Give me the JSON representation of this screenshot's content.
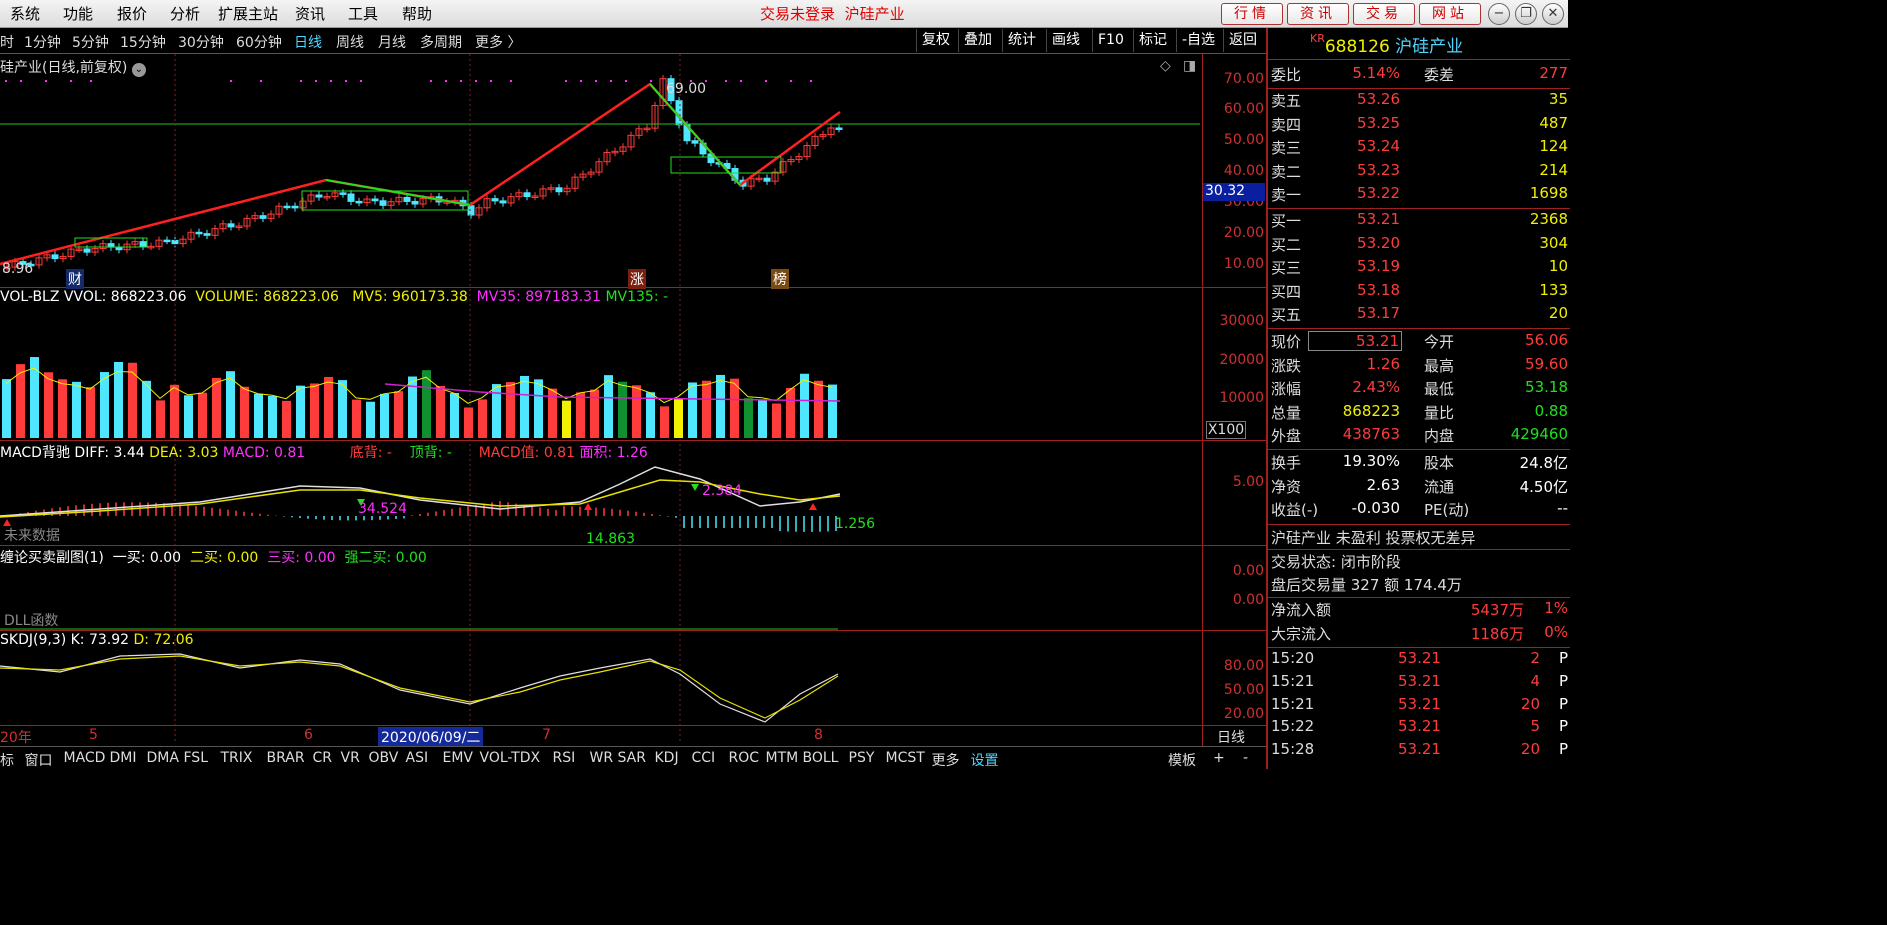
{
  "menubar": {
    "items": [
      "系统",
      "功能",
      "报价",
      "分析",
      "扩展主站",
      "资讯",
      "工具",
      "帮助"
    ],
    "status": "交易未登录",
    "stock_name": "沪硅产业",
    "buttons": [
      "行情",
      "资讯",
      "交易",
      "网站"
    ]
  },
  "periods": [
    "时",
    "1分钟",
    "5分钟",
    "15分钟",
    "30分钟",
    "60分钟",
    "日线",
    "周线",
    "月线",
    "多周期",
    "更多 〉"
  ],
  "toolbar": [
    "复权",
    "叠加",
    "统计",
    "画线",
    "F10",
    "标记",
    "-自选",
    "返回"
  ],
  "main_chart": {
    "title": "硅产业(日线,前复权)",
    "y_ticks": [
      "70.00",
      "60.00",
      "50.00",
      "40.00",
      "30.00",
      "20.00",
      "10.00"
    ],
    "high_label": "69.00",
    "low_label": "8.96",
    "current_marker": "30.32",
    "event_labels": [
      "财",
      "涨",
      "榜"
    ]
  },
  "volume": {
    "legend": {
      "name": "VOL-BLZ",
      "vvol": "VVOL: 868223.06",
      "volume": "VOLUME: 868223.06",
      "mv5": "MV5: 960173.38",
      "mv35": "MV35: 897183.31",
      "mv135": "MV135: -"
    },
    "y_ticks": [
      "30000",
      "20000",
      "10000"
    ],
    "unit": "X100"
  },
  "macd": {
    "legend": {
      "name": "MACD背驰",
      "diff": "DIFF: 3.44",
      "dea": "DEA: 3.03",
      "macd": "MACD: 0.81",
      "dibei": "底背: -",
      "dingbei": "顶背: -",
      "macdval": "MACD值: 0.81",
      "area": "面积: 1.26"
    },
    "y_ticks": [
      "5.00"
    ],
    "labels": [
      "34.524",
      "2.384",
      "14.863",
      "1.256"
    ],
    "note": "未来数据"
  },
  "chanlun": {
    "legend": {
      "name": "缠论买卖副图(1)",
      "b1": "一买: 0.00",
      "b2": "二买: 0.00",
      "b3": "三买: 0.00",
      "sb2": "强二买: 0.00"
    },
    "y_ticks": [
      "0.00",
      "0.00"
    ],
    "note": "DLL函数"
  },
  "skdj": {
    "legend": {
      "name": "SKDJ(9,3)",
      "k": "K: 73.92",
      "d": "D: 72.06"
    },
    "y_ticks": [
      "80.00",
      "50.00",
      "20.00"
    ]
  },
  "date_axis": {
    "labels": [
      "20年",
      "5",
      "6",
      "2020/06/09/二",
      "7",
      "8"
    ],
    "period": "日线"
  },
  "bottom_tabs": [
    "标",
    "窗口",
    "MACD",
    "DMI",
    "DMA",
    "FSL",
    "TRIX",
    "BRAR",
    "CR",
    "VR",
    "OBV",
    "ASI",
    "EMV",
    "VOL-TDX",
    "RSI",
    "WR",
    "SAR",
    "KDJ",
    "CCI",
    "ROC",
    "MTM",
    "BOLL",
    "PSY",
    "MCST",
    "更多",
    "设置"
  ],
  "bottom_right": [
    "模板",
    "+",
    "-"
  ],
  "quote": {
    "code": "688126",
    "name": "沪硅产业",
    "weibi": [
      "委比",
      "5.14%",
      "委差",
      "277"
    ],
    "sell": [
      [
        "卖五",
        "53.26",
        "35"
      ],
      [
        "卖四",
        "53.25",
        "487"
      ],
      [
        "卖三",
        "53.24",
        "124"
      ],
      [
        "卖二",
        "53.23",
        "214"
      ],
      [
        "卖一",
        "53.22",
        "1698"
      ]
    ],
    "buy": [
      [
        "买一",
        "53.21",
        "2368"
      ],
      [
        "买二",
        "53.20",
        "304"
      ],
      [
        "买三",
        "53.19",
        "10"
      ],
      [
        "买四",
        "53.18",
        "133"
      ],
      [
        "买五",
        "53.17",
        "20"
      ]
    ],
    "stats": [
      [
        "现价",
        "53.21",
        "今开",
        "56.06"
      ],
      [
        "涨跌",
        "1.26",
        "最高",
        "59.60"
      ],
      [
        "涨幅",
        "2.43%",
        "最低",
        "53.18"
      ],
      [
        "总量",
        "868223",
        "量比",
        "0.88"
      ],
      [
        "外盘",
        "438763",
        "内盘",
        "429460"
      ]
    ],
    "stats2": [
      [
        "换手",
        "19.30%",
        "股本",
        "24.8亿"
      ],
      [
        "净资",
        "2.63",
        "流通",
        "4.50亿"
      ],
      [
        "收益(-)",
        "-0.030",
        "PE(动)",
        "--"
      ]
    ],
    "tag": "沪硅产业 未盈利 投票权无差异",
    "trade_status": "交易状态: 闭市阶段",
    "after_hours": "盘后交易量 327 额 174.4万",
    "flows": [
      [
        "净流入额",
        "5437万",
        "1%"
      ],
      [
        "大宗流入",
        "1186万",
        "0%"
      ]
    ],
    "ticks": [
      [
        "15:20",
        "53.21",
        "2",
        "P"
      ],
      [
        "15:21",
        "53.21",
        "4",
        "P"
      ],
      [
        "15:21",
        "53.21",
        "20",
        "P"
      ],
      [
        "15:22",
        "53.21",
        "5",
        "P"
      ],
      [
        "15:28",
        "53.21",
        "20",
        "P"
      ]
    ]
  }
}
